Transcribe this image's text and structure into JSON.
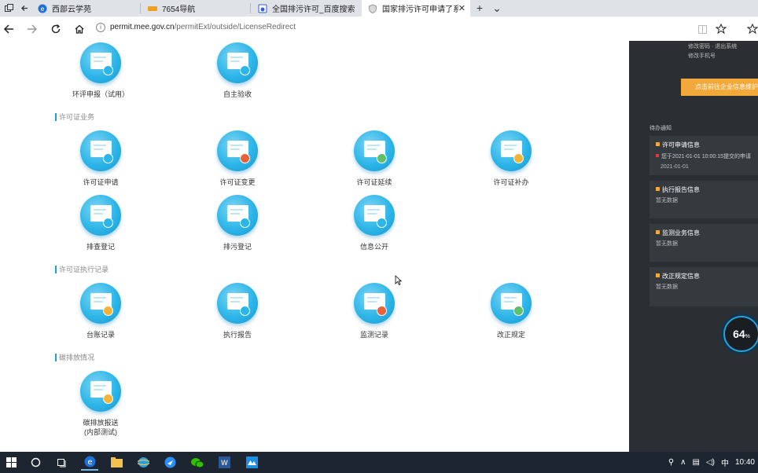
{
  "tabs": [
    {
      "title": "西部云学苑",
      "icon": "e-icon",
      "active": false
    },
    {
      "title": "7654导航",
      "icon": "navigation-site-icon",
      "active": false
    },
    {
      "title": "全国排污许可_百度搜索",
      "icon": "baidu-icon",
      "active": false
    },
    {
      "title": "国家排污许可申请了系统",
      "icon": "shield-site-icon",
      "active": true
    }
  ],
  "browser": {
    "url_domain": "permit.mee.gov.cn",
    "url_path": "/permitExt/outside/LicenseRedirect",
    "new_tab_glyph": "+",
    "tab_menu_glyph": "⌄",
    "close_glyph": "✕"
  },
  "top_items": [
    {
      "label": "环评申报（试用）",
      "icon": "document-upload-icon",
      "badge_color": "#2db5e8"
    },
    {
      "label": "自主验收",
      "icon": "calendar-check-icon",
      "badge_color": "#2db5e8"
    }
  ],
  "sections": [
    {
      "title": "许可证业务",
      "items": [
        {
          "label": "许可证申请",
          "icon": "certificate-apply-icon",
          "badge_color": "#2db5e8"
        },
        {
          "label": "许可证变更",
          "icon": "certificate-change-icon",
          "badge_color": "#e8613a"
        },
        {
          "label": "许可证延续",
          "icon": "certificate-extend-icon",
          "badge_color": "#5fbf6a"
        },
        {
          "label": "许可证补办",
          "icon": "certificate-reissue-icon",
          "badge_color": "#f2b53a"
        },
        {
          "label": "排查登记",
          "icon": "checklist-icon",
          "badge_color": "#2db5e8"
        },
        {
          "label": "排污登记",
          "icon": "id-card-icon",
          "badge_color": "#2db5e8"
        },
        {
          "label": "信息公开",
          "icon": "news-icon",
          "badge_color": "#2db5e8"
        }
      ]
    },
    {
      "title": "许可证执行记录",
      "items": [
        {
          "label": "台账记录",
          "icon": "ledger-icon",
          "badge_color": "#f2b53a"
        },
        {
          "label": "执行报告",
          "icon": "report-icon",
          "badge_color": "#2db5e8"
        },
        {
          "label": "监测记录",
          "icon": "monitor-chart-icon",
          "badge_color": "#e8613a"
        },
        {
          "label": "改正规定",
          "icon": "question-board-icon",
          "badge_color": "#5fbf6a"
        }
      ]
    },
    {
      "title": "碳排放情况",
      "items": [
        {
          "label": "碳排放报送\n(内部测试)",
          "icon": "folder-pen-icon",
          "badge_color": "#f2b53a"
        }
      ]
    }
  ],
  "sidebar": {
    "top_lines": [
      "修改密码 · 退出系统",
      "修改手机号"
    ],
    "action_button": "点击前往企业信息维护",
    "notices_heading": "待办通知",
    "cards": [
      {
        "title": "许可申请信息",
        "line": "您于2021-01-01 10:00:15提交的申请",
        "date": "2021-01-01"
      },
      {
        "title": "执行报告信息",
        "sub": "暂无数据"
      },
      {
        "title": "监测业务信息",
        "sub": "暂无数据"
      },
      {
        "title": "改正规定信息",
        "sub": "暂无数据"
      }
    ],
    "gauge_value": "64",
    "gauge_unit": "%"
  },
  "taskbar": {
    "apps": [
      "windows-icon",
      "search-icon",
      "task-view-icon",
      "edge-icon",
      "file-explorer-icon",
      "ie-icon",
      "feishu-icon",
      "wechat-icon",
      "word-icon",
      "ticket-app-icon"
    ],
    "tray_ime": "中",
    "tray_time": "10:40"
  }
}
